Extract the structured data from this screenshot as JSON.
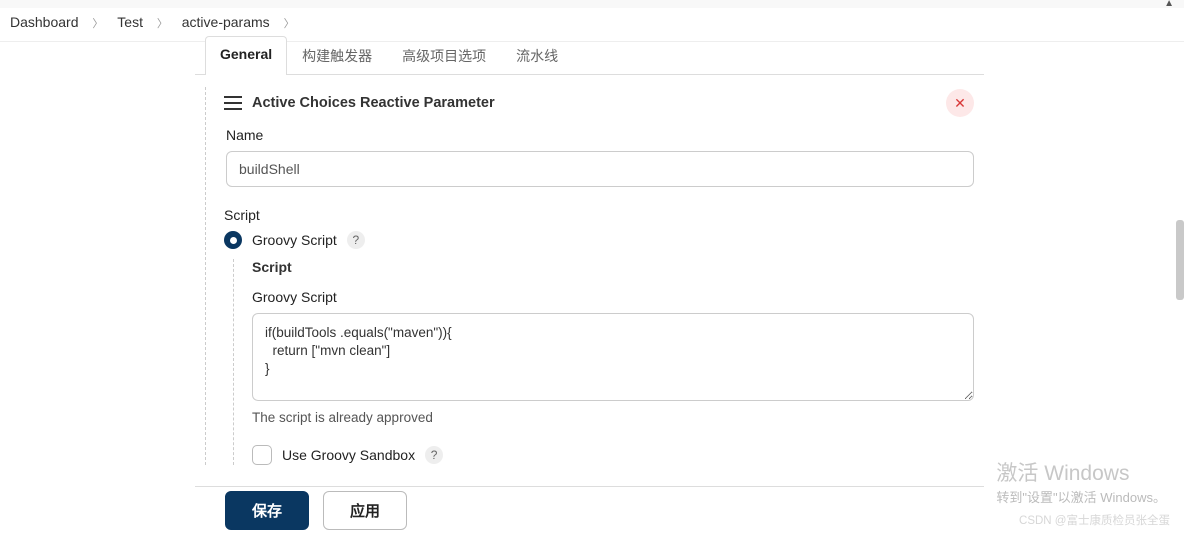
{
  "breadcrumb": {
    "items": [
      "Dashboard",
      "Test",
      "active-params"
    ]
  },
  "tabs": {
    "t0": "General",
    "t1": "构建触发器",
    "t2": "高级项目选项",
    "t3": "流水线"
  },
  "section": {
    "title": "Active Choices Reactive Parameter",
    "name_label": "Name",
    "name_value": "buildShell",
    "script_label": "Script",
    "radio_label": "Groovy Script",
    "sub_head": "Script",
    "groovy_label": "Groovy Script",
    "script_text": "if(buildTools .equals(\"maven\")){\n  return [\"mvn clean\"]\n}",
    "approved": "The script is already approved",
    "sandbox_label": "Use Groovy Sandbox"
  },
  "footer": {
    "save": "保存",
    "apply": "应用"
  },
  "watermark": {
    "line1": "激活 Windows",
    "line2": "转到\"设置\"以激活 Windows。"
  },
  "csdn": "CSDN @富士康质检员张全蛋"
}
